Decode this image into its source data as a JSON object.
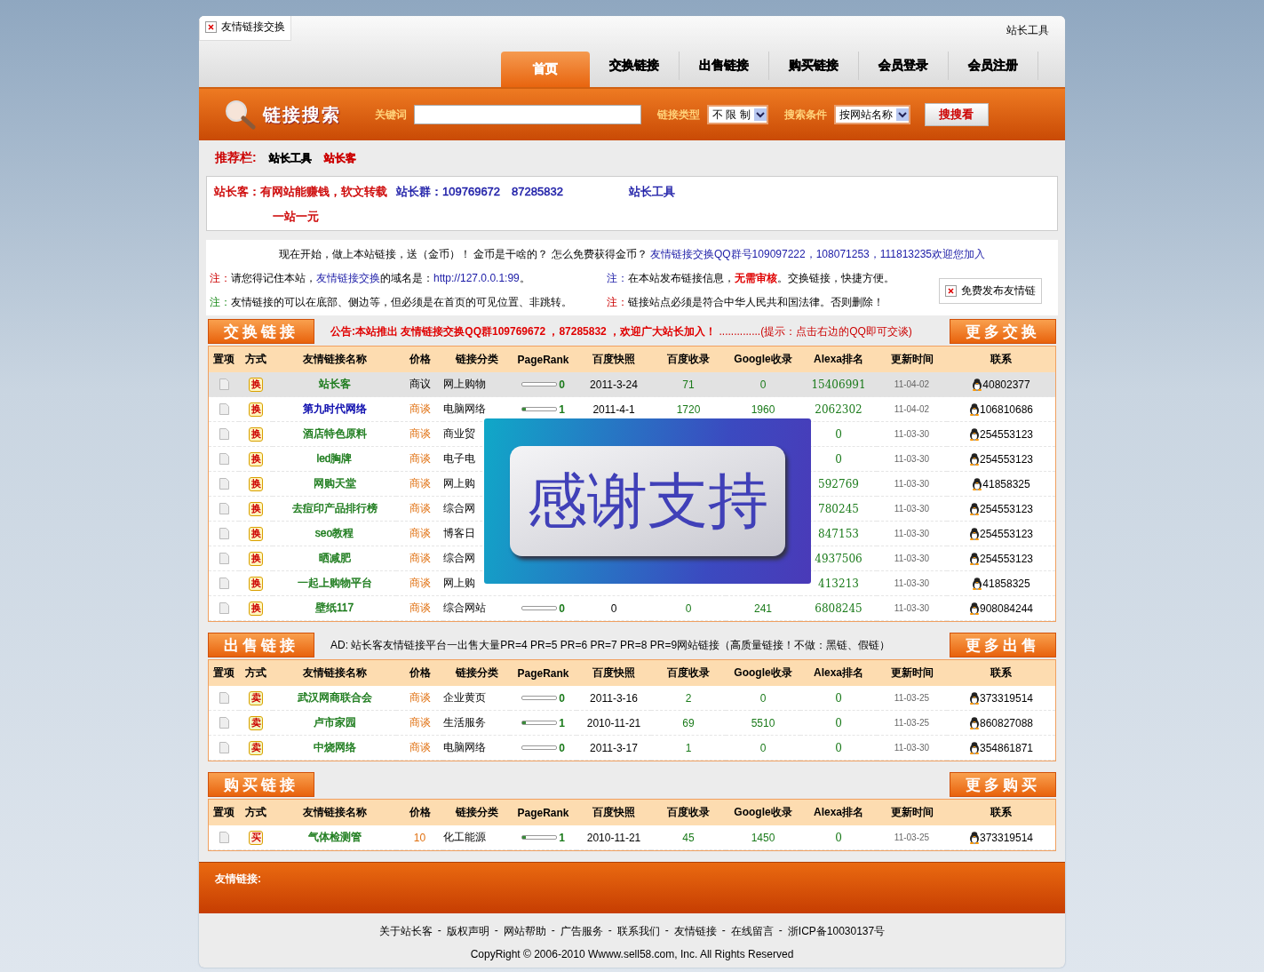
{
  "header": {
    "brand_tab": "友情链接交换",
    "top_link": "站长工具",
    "nav": [
      {
        "label": "首页",
        "selected": true
      },
      {
        "label": "交换链接",
        "selected": false
      },
      {
        "label": "出售链接",
        "selected": false
      },
      {
        "label": "购买链接",
        "selected": false
      },
      {
        "label": "会员登录",
        "selected": false
      },
      {
        "label": "会员注册",
        "selected": false
      }
    ]
  },
  "search": {
    "title": "链接搜索",
    "keyword_label": "关键词",
    "type_label": "链接类型",
    "type_value": "不 限 制",
    "cond_label": "搜索条件",
    "cond_value": "按网站名称",
    "button": "搜搜看"
  },
  "recommend": {
    "label": "推荐栏:",
    "links": [
      {
        "text": "站长工具",
        "color": "#000000"
      },
      {
        "text": "站长客",
        "color": "#cc0000"
      }
    ]
  },
  "ads": [
    [
      {
        "text": "站长客：有网站能赚钱，软文转载",
        "color": "#cc0000"
      },
      {
        "text": "站长群：109769672　87285832",
        "color": "#1a1aa6"
      },
      {
        "text": "站长工具",
        "color": "#1a1aa6"
      }
    ],
    [
      {
        "text": "一站一元",
        "color": "#cc0000"
      }
    ]
  ],
  "intro": [
    {
      "kind": "plain",
      "text": "现在开始，做上本站链接，送（金币）！ 金币是干啥的？ 怎么免费获得金币？ "
    },
    {
      "kind": "link",
      "text": "友情链接交换QQ群号109097222，108071253，111813235欢迎您加入"
    }
  ],
  "notes": [
    {
      "mark": "注：",
      "color": "#cc0000",
      "parts": [
        {
          "kind": "plain",
          "text": "请您得记住本站，"
        },
        {
          "kind": "link",
          "text": "友情链接交换"
        },
        {
          "kind": "plain",
          "text": "的域名是："
        },
        {
          "kind": "link",
          "text": "http://127.0.0.1:99"
        },
        {
          "kind": "plain",
          "text": "。"
        }
      ]
    },
    {
      "mark": "注：",
      "color": "#1a1aa6",
      "parts": [
        {
          "kind": "plain",
          "text": "在本站发布链接信息，"
        },
        {
          "kind": "alert",
          "text": "无需审核"
        },
        {
          "kind": "plain",
          "text": "。交换链接，快捷方便。"
        }
      ]
    },
    {
      "mark": "注：",
      "color": "#1a8a1a",
      "parts": [
        {
          "kind": "plain",
          "text": "友情链接的可以在底部、侧边等，但必须是在首页的可见位置、非跳转。"
        }
      ]
    },
    {
      "mark": "注：",
      "color": "#cc0000",
      "parts": [
        {
          "kind": "plain",
          "text": "链接站点必须是符合中华人民共和国法律。否则删除！"
        }
      ]
    }
  ],
  "free_post": "免费发布友情链",
  "sections": [
    {
      "title": "交换链接",
      "more": "更多交换",
      "notice": [
        {
          "kind": "alert",
          "text": "公告:本站推出 友情链接交换QQ群109769672 ，87285832 ，欢迎广大站长加入！"
        },
        {
          "kind": "hint",
          "text": " ..............(提示：点击右边的QQ即可交谈)"
        }
      ],
      "columns": [
        "置项",
        "方式",
        "友情链接名称",
        "价格",
        "链接分类",
        "PageRank",
        "百度快照",
        "百度收录",
        "Google收录",
        "Alexa排名",
        "更新时间",
        "联系"
      ],
      "rows": [
        {
          "highlighted": true,
          "mode": "换",
          "name": {
            "text": "站长客",
            "color": "#1a7a1a"
          },
          "price": {
            "text": "商议",
            "color": "#000000"
          },
          "category": "网上购物",
          "pr": "0",
          "level": 0,
          "snapshot": "2011-3-24",
          "baidu": "71",
          "google": "0",
          "alexa": "15406991",
          "updated": "11-04-02",
          "qq": "40802377"
        },
        {
          "highlighted": false,
          "mode": "换",
          "name": {
            "text": "第九时代网络",
            "color": "#0000aa"
          },
          "price": {
            "text": "商谈",
            "color": "#e07010"
          },
          "category": "电脑网络",
          "pr": "1",
          "level": 0.1,
          "snapshot": "2011-4-1",
          "baidu": "1720",
          "google": "1960",
          "alexa": "2062302",
          "updated": "11-04-02",
          "qq": "106810686"
        },
        {
          "highlighted": false,
          "mode": "换",
          "name": {
            "text": "酒店特色原料",
            "color": "#1a7a1a"
          },
          "price": {
            "text": "商谈",
            "color": "#e07010"
          },
          "category": "商业贸",
          "alexa": "0",
          "updated": "11-03-30",
          "qq": "254553123"
        },
        {
          "highlighted": false,
          "mode": "换",
          "name": {
            "text": "led胸牌",
            "color": "#1a7a1a"
          },
          "price": {
            "text": "商谈",
            "color": "#e07010"
          },
          "category": "电子电",
          "alexa": "0",
          "updated": "11-03-30",
          "qq": "254553123"
        },
        {
          "highlighted": false,
          "mode": "换",
          "name": {
            "text": "网购天堂",
            "color": "#1a7a1a"
          },
          "price": {
            "text": "商谈",
            "color": "#e07010"
          },
          "category": "网上购",
          "alexa": "592769",
          "updated": "11-03-30",
          "qq": "41858325"
        },
        {
          "highlighted": false,
          "mode": "换",
          "name": {
            "text": "去痘印产品排行榜",
            "color": "#1a7a1a"
          },
          "price": {
            "text": "商谈",
            "color": "#e07010"
          },
          "category": "综合网",
          "alexa": "780245",
          "updated": "11-03-30",
          "qq": "254553123"
        },
        {
          "highlighted": false,
          "mode": "换",
          "name": {
            "text": "seo教程",
            "color": "#1a7a1a"
          },
          "price": {
            "text": "商谈",
            "color": "#e07010"
          },
          "category": "博客日",
          "alexa": "847153",
          "updated": "11-03-30",
          "qq": "254553123"
        },
        {
          "highlighted": false,
          "mode": "换",
          "name": {
            "text": "晒减肥",
            "color": "#1a7a1a"
          },
          "price": {
            "text": "商谈",
            "color": "#e07010"
          },
          "category": "综合网",
          "alexa": "4937506",
          "updated": "11-03-30",
          "qq": "254553123"
        },
        {
          "highlighted": false,
          "mode": "换",
          "name": {
            "text": "一起上购物平台",
            "color": "#1a7a1a"
          },
          "price": {
            "text": "商谈",
            "color": "#e07010"
          },
          "category": "网上购",
          "alexa": "413213",
          "updated": "11-03-30",
          "qq": "41858325"
        },
        {
          "highlighted": false,
          "mode": "换",
          "name": {
            "text": "壁纸117",
            "color": "#1a7a1a"
          },
          "price": {
            "text": "商谈",
            "color": "#e07010"
          },
          "category": "综合网站",
          "pr": "0",
          "level": 0,
          "snapshot": "0",
          "baidu": "0",
          "google": "241",
          "alexa": "6808245",
          "updated": "11-03-30",
          "qq": "908084244"
        }
      ],
      "overlay": {
        "text": "感谢支持"
      }
    },
    {
      "title": "出售链接",
      "more": "更多出售",
      "notice": [
        {
          "kind": "plain",
          "text": "AD: 站长客友情链接平台一出售大量PR=4 PR=5 PR=6 PR=7 PR=8 PR=9网站链接（高质量链接！不做：黑链、假链）"
        }
      ],
      "columns": [
        "置项",
        "方式",
        "友情链接名称",
        "价格",
        "链接分类",
        "PageRank",
        "百度快照",
        "百度收录",
        "Google收录",
        "Alexa排名",
        "更新时间",
        "联系"
      ],
      "rows": [
        {
          "highlighted": false,
          "mode": "卖",
          "name": {
            "text": "武汉网商联合会",
            "color": "#1a7a1a"
          },
          "price": {
            "text": "商谈",
            "color": "#e07010"
          },
          "category": "企业黄页",
          "pr": "0",
          "level": 0,
          "snapshot": "2011-3-16",
          "baidu": "2",
          "google": "0",
          "alexa": "0",
          "updated": "11-03-25",
          "qq": "373319514"
        },
        {
          "highlighted": false,
          "mode": "卖",
          "name": {
            "text": "卢市家园",
            "color": "#1a7a1a"
          },
          "price": {
            "text": "商谈",
            "color": "#e07010"
          },
          "category": "生活服务",
          "pr": "1",
          "level": 0.1,
          "snapshot": "2010-11-21",
          "baidu": "69",
          "google": "5510",
          "alexa": "0",
          "updated": "11-03-25",
          "qq": "860827088"
        },
        {
          "highlighted": false,
          "mode": "卖",
          "name": {
            "text": "中烧网络",
            "color": "#1a7a1a"
          },
          "price": {
            "text": "商谈",
            "color": "#e07010"
          },
          "category": "电脑网络",
          "pr": "0",
          "level": 0,
          "snapshot": "2011-3-17",
          "baidu": "1",
          "google": "0",
          "alexa": "0",
          "updated": "11-03-30",
          "qq": "354861871"
        }
      ]
    },
    {
      "title": "购买链接",
      "more": "更多购买",
      "columns": [
        "置项",
        "方式",
        "友情链接名称",
        "价格",
        "链接分类",
        "PageRank",
        "百度快照",
        "百度收录",
        "Google收录",
        "Alexa排名",
        "更新时间",
        "联系"
      ],
      "rows": [
        {
          "highlighted": false,
          "mode": "买",
          "name": {
            "text": "气体检测管",
            "color": "#1a7a1a"
          },
          "price": {
            "text": "10",
            "color": "#e07010"
          },
          "category": "化工能源",
          "pr": "1",
          "level": 0.1,
          "snapshot": "2010-11-21",
          "baidu": "45",
          "google": "1450",
          "alexa": "0",
          "updated": "11-03-25",
          "qq": "373319514"
        }
      ]
    }
  ],
  "friend_links": {
    "label": "友情链接:"
  },
  "footer": {
    "separator": "-",
    "links": [
      "关于站长客",
      "版权声明",
      "网站帮助",
      "广告服务",
      "联系我们",
      "友情链接",
      "在线留言",
      "浙ICP备10030137号"
    ],
    "copyright": "CopyRight © 2006-2010 Wwww.sell58.com, Inc. All Rights Reserved"
  }
}
